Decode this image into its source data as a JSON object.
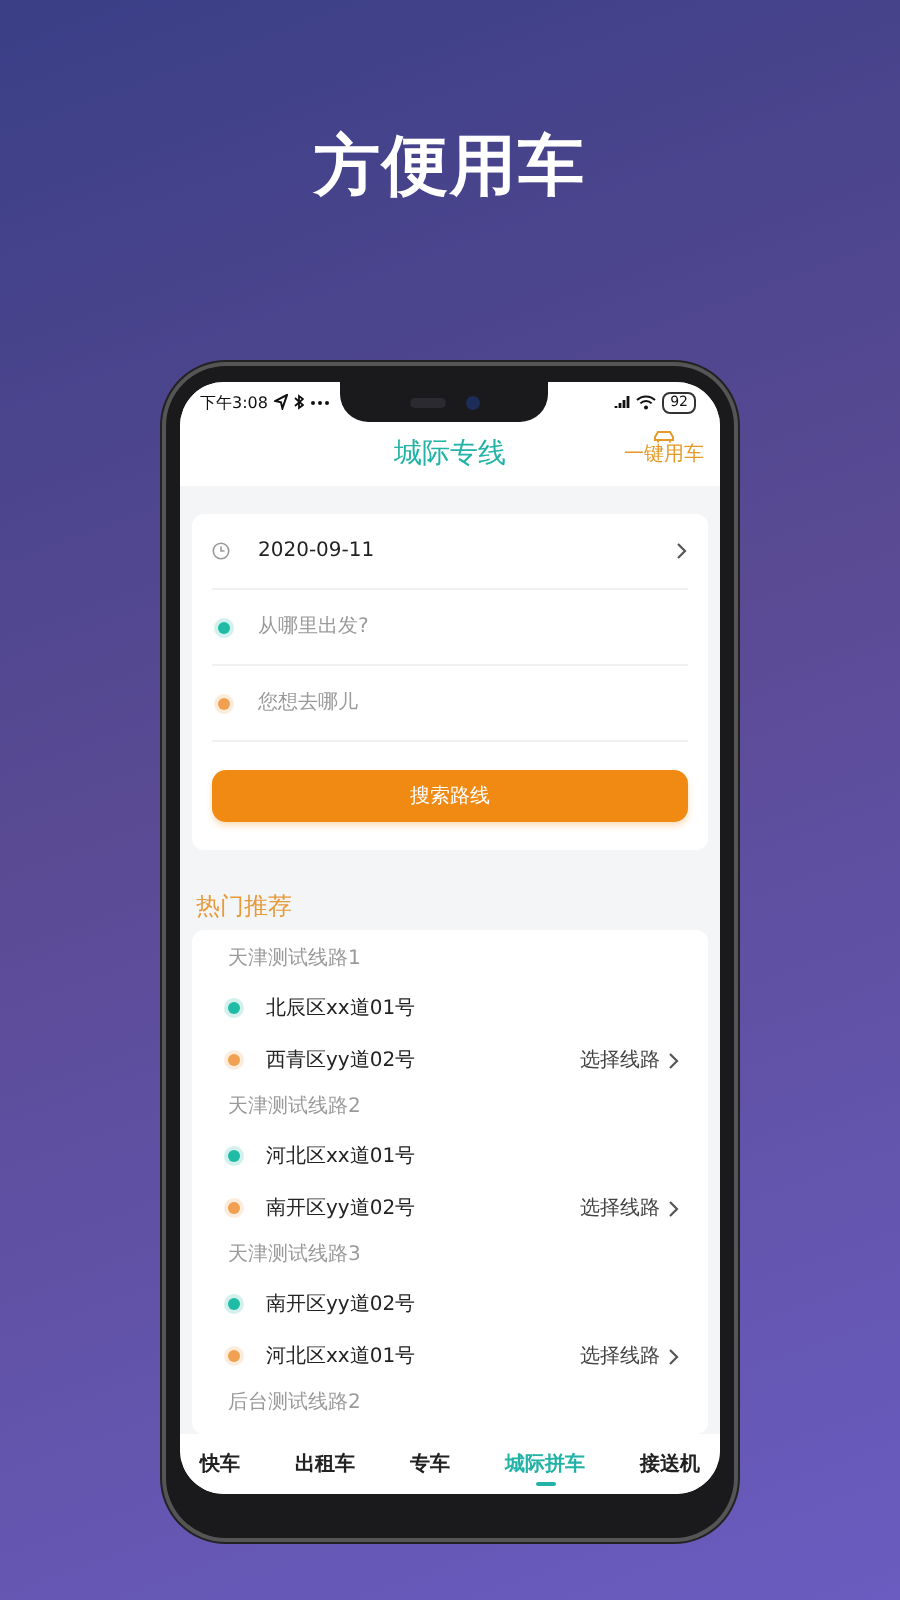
{
  "headline": "方便用车",
  "status_bar": {
    "time": "下午3:08",
    "battery": "92"
  },
  "header": {
    "title": "城际专线",
    "action": "一键用车"
  },
  "search_form": {
    "date": "2020-09-11",
    "origin": {
      "placeholder": "从哪里出发?"
    },
    "destination": {
      "placeholder": "您想去哪儿"
    },
    "button": "搜索路线"
  },
  "recommend": {
    "title": "热门推荐",
    "routes": [
      {
        "name": "天津测试线路1",
        "from": "北辰区xx道01号",
        "to": "西青区yy道02号",
        "action": "选择线路"
      },
      {
        "name": "天津测试线路2",
        "from": "河北区xx道01号",
        "to": "南开区yy道02号",
        "action": "选择线路"
      },
      {
        "name": "天津测试线路3",
        "from": "南开区yy道02号",
        "to": "河北区xx道01号",
        "action": "选择线路"
      },
      {
        "name": "后台测试线路2"
      }
    ]
  },
  "tabs": [
    {
      "label": "快车",
      "selected": false
    },
    {
      "label": "出租车",
      "selected": false
    },
    {
      "label": "专车",
      "selected": false
    },
    {
      "label": "城际拼车",
      "selected": true
    },
    {
      "label": "接送机",
      "selected": false
    }
  ]
}
